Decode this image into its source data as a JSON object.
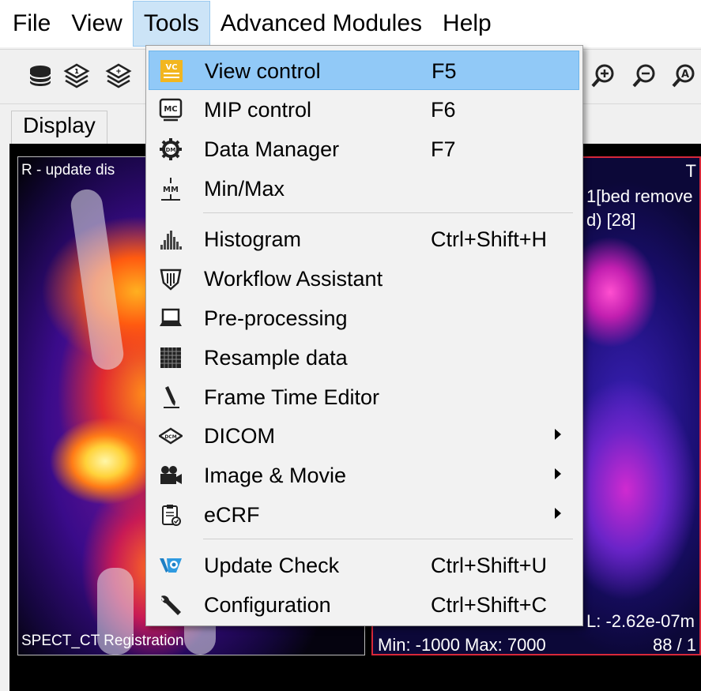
{
  "menubar": {
    "items": [
      "File",
      "View",
      "Tools",
      "Advanced Modules",
      "Help"
    ],
    "open_item": "Tools"
  },
  "panel": {
    "title": "Display"
  },
  "viewport_left": {
    "top_label": "R - update dis",
    "bottom_label": "SPECT_CT Registration"
  },
  "viewport_right": {
    "top_right": "T",
    "line1": "1[bed remove",
    "line2": "d) [28]",
    "line3": "L: -2.62e-07m",
    "minmax": "Min: -1000 Max: 7000",
    "slice": "88 / 1"
  },
  "tools_menu": {
    "items": [
      {
        "label": "View control",
        "shortcut": "F5",
        "icon": "view-control-icon",
        "highlighted": true
      },
      {
        "label": "MIP control",
        "shortcut": "F6",
        "icon": "mip-control-icon"
      },
      {
        "label": "Data Manager",
        "shortcut": "F7",
        "icon": "data-manager-icon"
      },
      {
        "label": "Min/Max",
        "shortcut": "",
        "icon": "min-max-icon"
      },
      {
        "label": "Histogram",
        "shortcut": "Ctrl+Shift+H",
        "icon": "histogram-icon"
      },
      {
        "label": "Workflow Assistant",
        "shortcut": "",
        "icon": "workflow-assistant-icon"
      },
      {
        "label": "Pre-processing",
        "shortcut": "",
        "icon": "laptop-icon"
      },
      {
        "label": "Resample data",
        "shortcut": "",
        "icon": "grid-icon"
      },
      {
        "label": "Frame Time Editor",
        "shortcut": "",
        "icon": "pen-icon"
      },
      {
        "label": "DICOM",
        "shortcut": "",
        "icon": "dicom-icon",
        "submenu": true
      },
      {
        "label": "Image & Movie",
        "shortcut": "",
        "icon": "camera-icon",
        "submenu": true
      },
      {
        "label": "eCRF",
        "shortcut": "",
        "icon": "clipboard-icon",
        "submenu": true
      },
      {
        "label": "Update Check",
        "shortcut": "Ctrl+Shift+U",
        "icon": "update-check-icon"
      },
      {
        "label": "Configuration",
        "shortcut": "Ctrl+Shift+C",
        "icon": "wrench-icon"
      }
    ]
  },
  "colors": {
    "menu_open": "#cce4f7",
    "item_highlight": "#91c9f7",
    "viewport_border_active": "#d8283a"
  }
}
